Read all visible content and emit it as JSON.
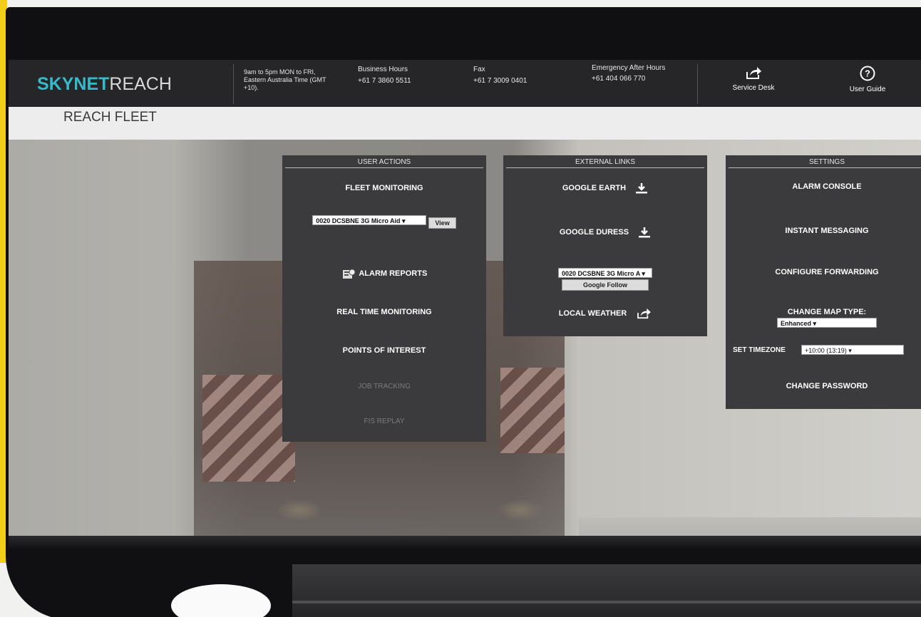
{
  "app": {
    "logo_primary": "SKYNET",
    "logo_secondary": "REACH",
    "page_title": "REACH FLEET"
  },
  "header": {
    "hours_text": "9am to 5pm MON to FRI, Eastern Australia Time (GMT +10).",
    "business_hours_label": "Business Hours",
    "business_hours_phone": "+61 7 3860 5511",
    "fax_label": "Fax",
    "fax_number": "+61 7 3009 0401",
    "emergency_label": "Emergency After Hours",
    "emergency_phone": "+61 404 066 770",
    "service_desk_label": "Service Desk",
    "user_guide_label": "User Guide"
  },
  "user_actions": {
    "title": "USER ACTIONS",
    "fleet_monitoring": "FLEET MONITORING",
    "device_select_value": "0020 DCSBNE 3G Micro Aid",
    "view_button": "View",
    "alarm_reports": "ALARM REPORTS",
    "real_time_monitoring": "REAL TIME MONITORING",
    "points_of_interest": "POINTS OF INTEREST",
    "job_tracking": "JOB TRACKING",
    "fis_replay": "FIS REPLAY"
  },
  "external_links": {
    "title": "EXTERNAL LINKS",
    "google_earth": "GOOGLE EARTH",
    "google_duress": "GOOGLE DURESS",
    "device_select_value": "0020 DCSBNE 3G Micro A",
    "google_follow_button": "Google Follow",
    "local_weather": "LOCAL WEATHER"
  },
  "settings": {
    "title": "SETTINGS",
    "alarm_console": "ALARM CONSOLE",
    "instant_messaging": "INSTANT MESSAGING",
    "configure_forwarding": "CONFIGURE FORWARDING",
    "change_map_type": "CHANGE MAP TYPE:",
    "map_type_value": "Enhanced",
    "set_timezone": "SET TIMEZONE",
    "timezone_value": "+10:00 (13:19)",
    "change_password": "CHANGE PASSWORD"
  },
  "colors": {
    "brand_accent": "#36b9c9",
    "header_bg": "#262628",
    "panel_bg": "#3b3b3d"
  },
  "icons": {
    "service_desk": "share-icon",
    "user_guide": "help-circle-icon",
    "google_earth": "download-icon",
    "google_duress": "download-icon",
    "local_weather": "share-icon",
    "alarm_reports": "report-icon"
  }
}
